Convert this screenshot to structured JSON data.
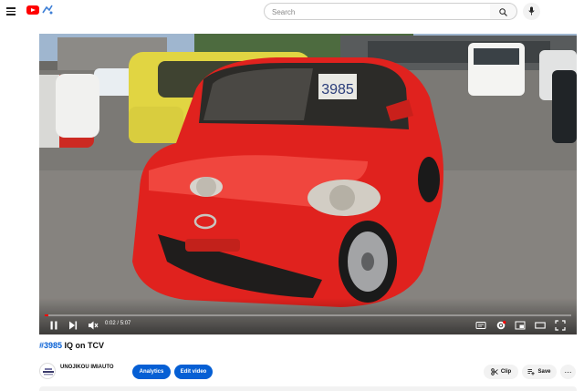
{
  "masthead": {
    "search": {
      "placeholder": "Search"
    },
    "icons": {
      "menu": "hamburger-menu-icon",
      "logo": "youtube-logo-icon",
      "search": "search-icon",
      "mic": "microphone-icon"
    }
  },
  "player": {
    "plate_text": "3985",
    "time_current": "0:02",
    "time_separator": "/",
    "time_total": "5:07",
    "progress_fraction": 0.007,
    "accent_color": "#ff0000"
  },
  "video": {
    "hashtag": "#3985",
    "title_rest": " IQ on TCV"
  },
  "channel": {
    "name": "UNOJIKOU IMIAUTO"
  },
  "actions": {
    "analytics": "Analytics",
    "edit_video": "Edit video",
    "clip": "Clip",
    "save": "Save",
    "more": "⋯"
  }
}
